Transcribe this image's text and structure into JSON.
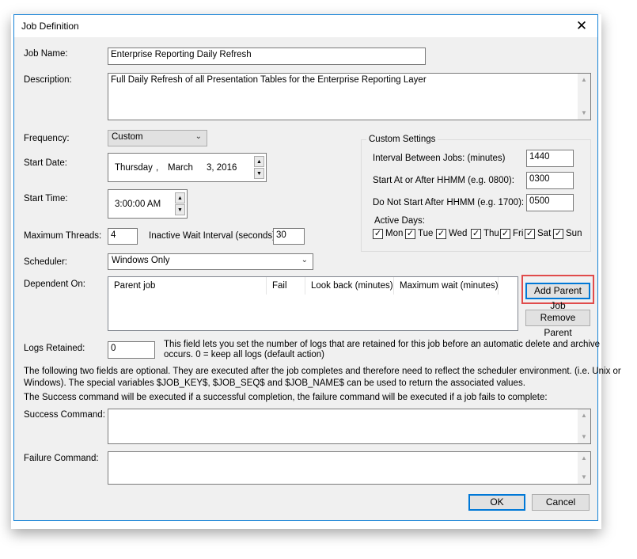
{
  "dialog": {
    "title": "Job Definition"
  },
  "job_name": {
    "label": "Job Name:",
    "value": "Enterprise Reporting Daily Refresh"
  },
  "description": {
    "label": "Description:",
    "value": "Full Daily Refresh of all Presentation Tables for the Enterprise Reporting Layer"
  },
  "frequency": {
    "label": "Frequency:",
    "value": "Custom"
  },
  "start_date": {
    "label": "Start Date:",
    "weekday": "Thursday",
    "comma1": ",",
    "month": "March",
    "day_year": "3, 2016"
  },
  "start_time": {
    "label": "Start Time:",
    "value": "3:00:00 AM"
  },
  "max_threads": {
    "label": "Maximum Threads:",
    "value": "4"
  },
  "inactive_wait": {
    "label": "Inactive Wait Interval (seconds):",
    "value": "30"
  },
  "scheduler": {
    "label": "Scheduler:",
    "value": "Windows Only"
  },
  "custom_settings": {
    "title": "Custom Settings",
    "interval_label": "Interval Between Jobs: (minutes)",
    "interval_value": "1440",
    "start_after_label": "Start At or After HHMM (e.g. 0800):",
    "start_after_value": "0300",
    "not_after_label": "Do Not Start After HHMM (e.g. 1700):",
    "not_after_value": "0500",
    "active_days_label": "Active Days:",
    "days": [
      {
        "label": "Mon",
        "checked": true
      },
      {
        "label": "Tue",
        "checked": true
      },
      {
        "label": "Wed",
        "checked": true
      },
      {
        "label": "Thu",
        "checked": true
      },
      {
        "label": "Fri",
        "checked": true
      },
      {
        "label": "Sat",
        "checked": true
      },
      {
        "label": "Sun",
        "checked": true
      }
    ]
  },
  "dependent": {
    "label": "Dependent On:",
    "columns": [
      "Parent job",
      "Fail",
      "Look back (minutes)",
      "Maximum wait (minutes)"
    ],
    "add_button": "Add Parent Job",
    "remove_button": "Remove Parent"
  },
  "logs": {
    "label": "Logs Retained:",
    "value": "0",
    "help1": "This field lets you set the number of logs that are retained for this job before an automatic delete and archive",
    "help2": "occurs. 0 = keep all logs (default action)"
  },
  "info": {
    "line1": "The following two fields are optional. They are executed after the job completes and therefore need to reflect the scheduler environment. (i.e. Unix or",
    "line2": "Windows). The special variables $JOB_KEY$, $JOB_SEQ$ and $JOB_NAME$ can be used to return the associated values.",
    "line3": "The Success command will be executed if a successful completion, the failure command will be executed if a job fails to complete:"
  },
  "success_cmd": {
    "label": "Success Command:",
    "value": ""
  },
  "failure_cmd": {
    "label": "Failure Command:",
    "value": ""
  },
  "buttons": {
    "ok": "OK",
    "cancel": "Cancel"
  },
  "colors": {
    "accent": "#0078d7",
    "highlight": "#e04b4b",
    "dialog_bg": "#f0f0f0"
  },
  "icons": {
    "close": "close-icon",
    "dropdown": "chevron-down-icon",
    "check": "check-icon"
  }
}
